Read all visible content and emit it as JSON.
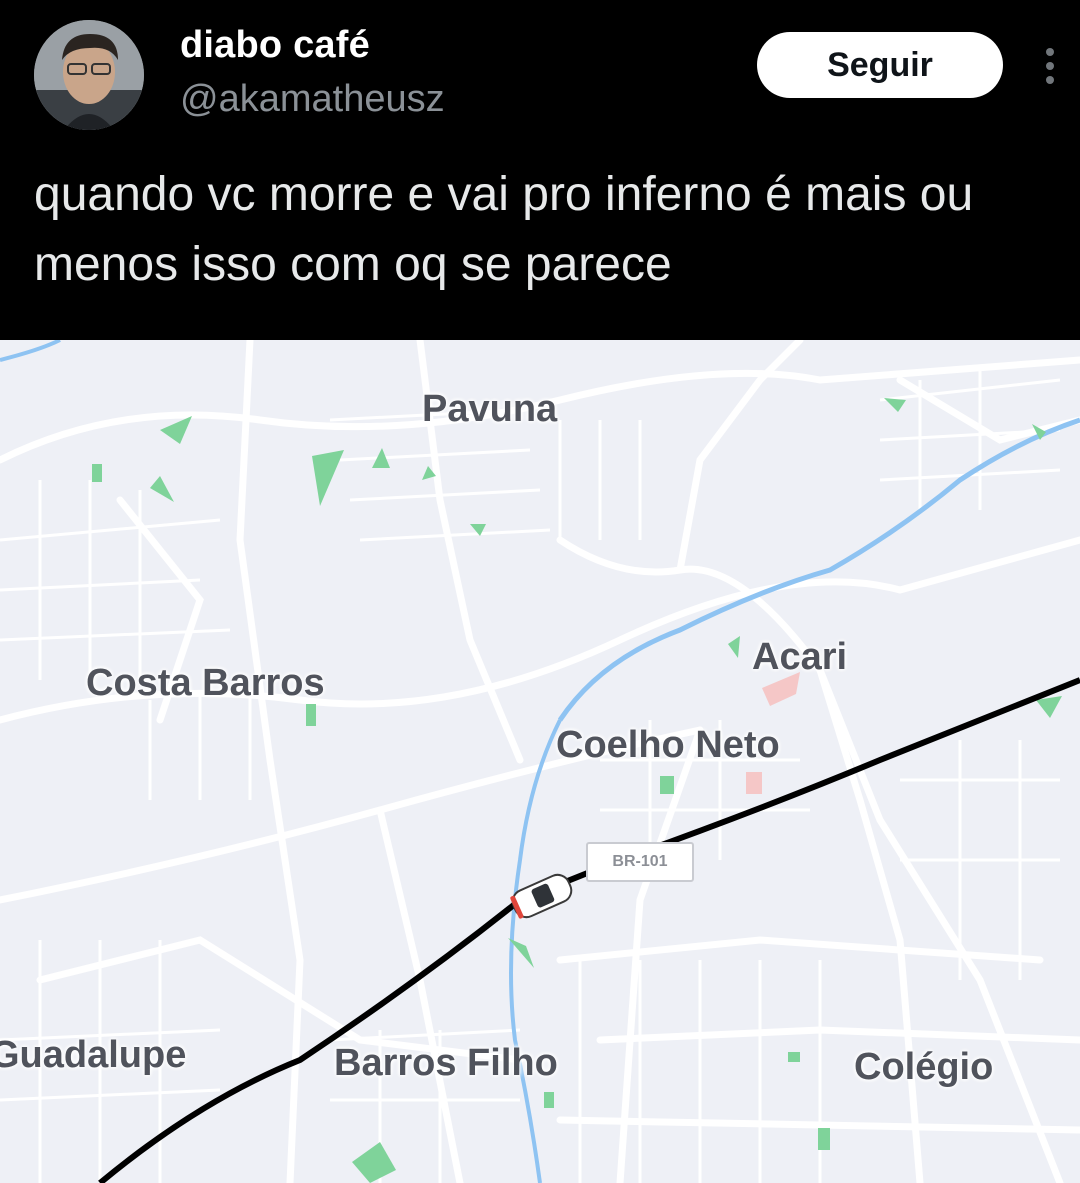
{
  "tweet": {
    "display_name": "diabo café",
    "handle": "@akamatheusz",
    "follow_label": "Seguir",
    "text": "quando vc morre e vai pro inferno é mais ou menos isso com oq se parece",
    "icons": {
      "avatar": "profile-photo",
      "more": "more-vertical-icon"
    }
  },
  "map": {
    "places": {
      "pavuna": "Pavuna",
      "costa_barros": "Costa Barros",
      "acari": "Acari",
      "coelho_neto": "Coelho Neto",
      "guadalupe": "Guadalupe",
      "barros_filho": "Barros Filho",
      "colegio": "Colégio"
    },
    "road_shield": "BR-101",
    "icons": {
      "vehicle": "car-icon"
    },
    "colors": {
      "route": "#000000",
      "water": "#8ec3f2",
      "park": "#7fd39a",
      "background": "#eef0f6"
    }
  }
}
